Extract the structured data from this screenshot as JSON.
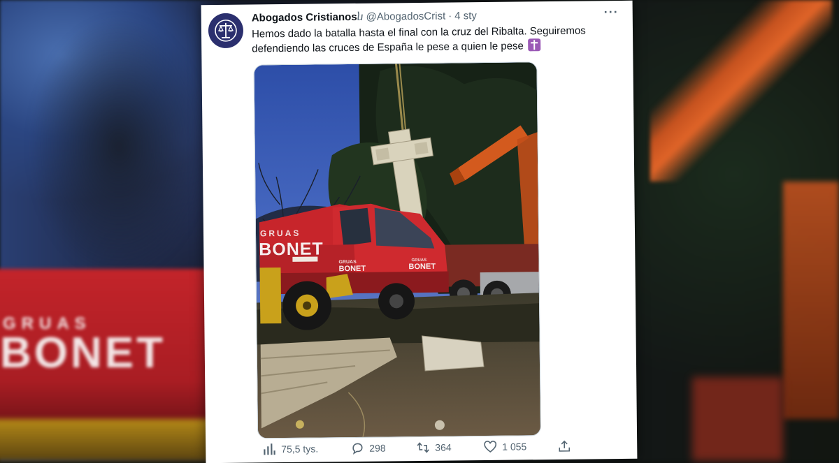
{
  "tweet": {
    "display_name": "Abogados Cristianos",
    "verified_glyph": "ⴑ",
    "handle": "@AbogadosCrist",
    "separator": "·",
    "date": "4 sty",
    "text_line1": "Hemos dado la batalla hasta el final con la cruz del Ribalta. Seguiremos",
    "text_line2": "defendiendo las cruces de España le pese a quien le pese",
    "more_label": "···",
    "emoji": "latin-cross-emoji"
  },
  "photo": {
    "truck_small_text": "GRUAS",
    "truck_big_text": "BONET",
    "cab_small_text": "GRUAS",
    "cab_text": "BONET",
    "grille_small_text": "GRUAS",
    "grille_text": "BONET"
  },
  "background": {
    "truck_small_text": "GRUAS",
    "truck_big_text": "BONET"
  },
  "actions": {
    "views": "75,5 tys.",
    "replies": "298",
    "retweets": "364",
    "likes": "1 055"
  },
  "colors": {
    "avatar_bg": "#2b2f6e",
    "emoji_bg": "#9b59b6",
    "secondary_text": "#536471",
    "primary_text": "#0f1419",
    "truck_red": "#c7252b"
  }
}
